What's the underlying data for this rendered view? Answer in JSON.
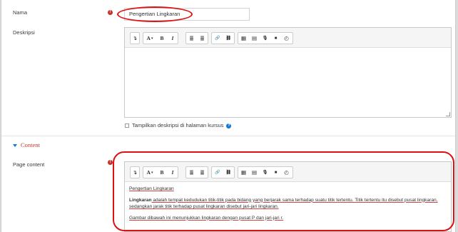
{
  "form": {
    "name_label": "Nama",
    "name_value": "Pengertian Lingkaran",
    "desc_label": "Deskripsi",
    "show_desc_label": "Tampilkan deskripsi di halaman kursus",
    "section_title": "Content",
    "page_content_label": "Page content"
  },
  "toolbar": {
    "expand": "↴",
    "text_style": "A",
    "bold": "B",
    "italic": "I",
    "unordered_list": "≣",
    "ordered_list": "≣",
    "link": "🔗",
    "unlink": "⛓",
    "image": "▦",
    "media": "▤",
    "record_audio": "🎙",
    "record_video": "■",
    "manage_files": "◴"
  },
  "content": {
    "heading": "Pengertian Lingkaran",
    "para1_bold": "Lingkaran",
    "para1_rest": " adalah tempat kedudukan titik-titik pada bidang yang berjarak sama terhadap suatu titik tertentu. Titik tertentu itu disebut pusat lingkaran, sedangkan jarak titik terhadap pusat lingkaran disebut jari-jari lingkaran.",
    "para2": "Gambar dibawah ini menunjukkan lingkaran dengan pusat P dan jari-jari r."
  },
  "colors": {
    "required": "#c9302c",
    "accent_red": "#d11111",
    "help": "#1177d1"
  }
}
